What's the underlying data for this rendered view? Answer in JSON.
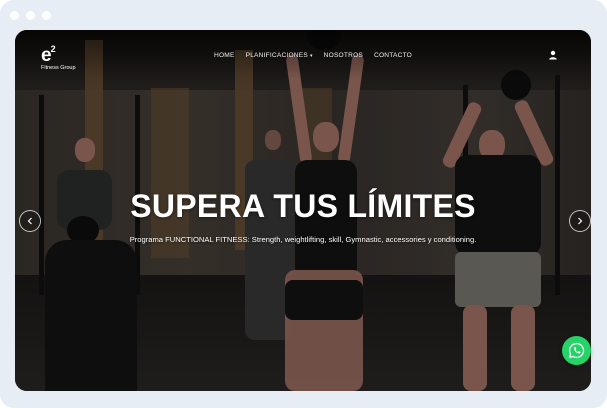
{
  "brand": {
    "mark": "e",
    "superscript": "2",
    "subtitle": "Fitness Group"
  },
  "nav": {
    "items": [
      {
        "label": "HOME"
      },
      {
        "label": "PLANIFICACIONES",
        "has_dropdown": true
      },
      {
        "label": "NOSOTROS"
      },
      {
        "label": "CONTACTO"
      }
    ],
    "user_icon": "user-icon"
  },
  "hero": {
    "title": "SUPERA TUS LÍMITES",
    "subtitle": "Programa FUNCTIONAL FITNESS: Strength, weightlifting, skill, Gymnastic, accessories y conditioning."
  },
  "slider": {
    "prev_icon": "chevron-left-icon",
    "next_icon": "chevron-right-icon"
  },
  "whatsapp": {
    "icon": "whatsapp-icon",
    "color": "#25d366"
  },
  "colors": {
    "frame": "#e7edf4",
    "overlay_text": "#ffffff"
  }
}
